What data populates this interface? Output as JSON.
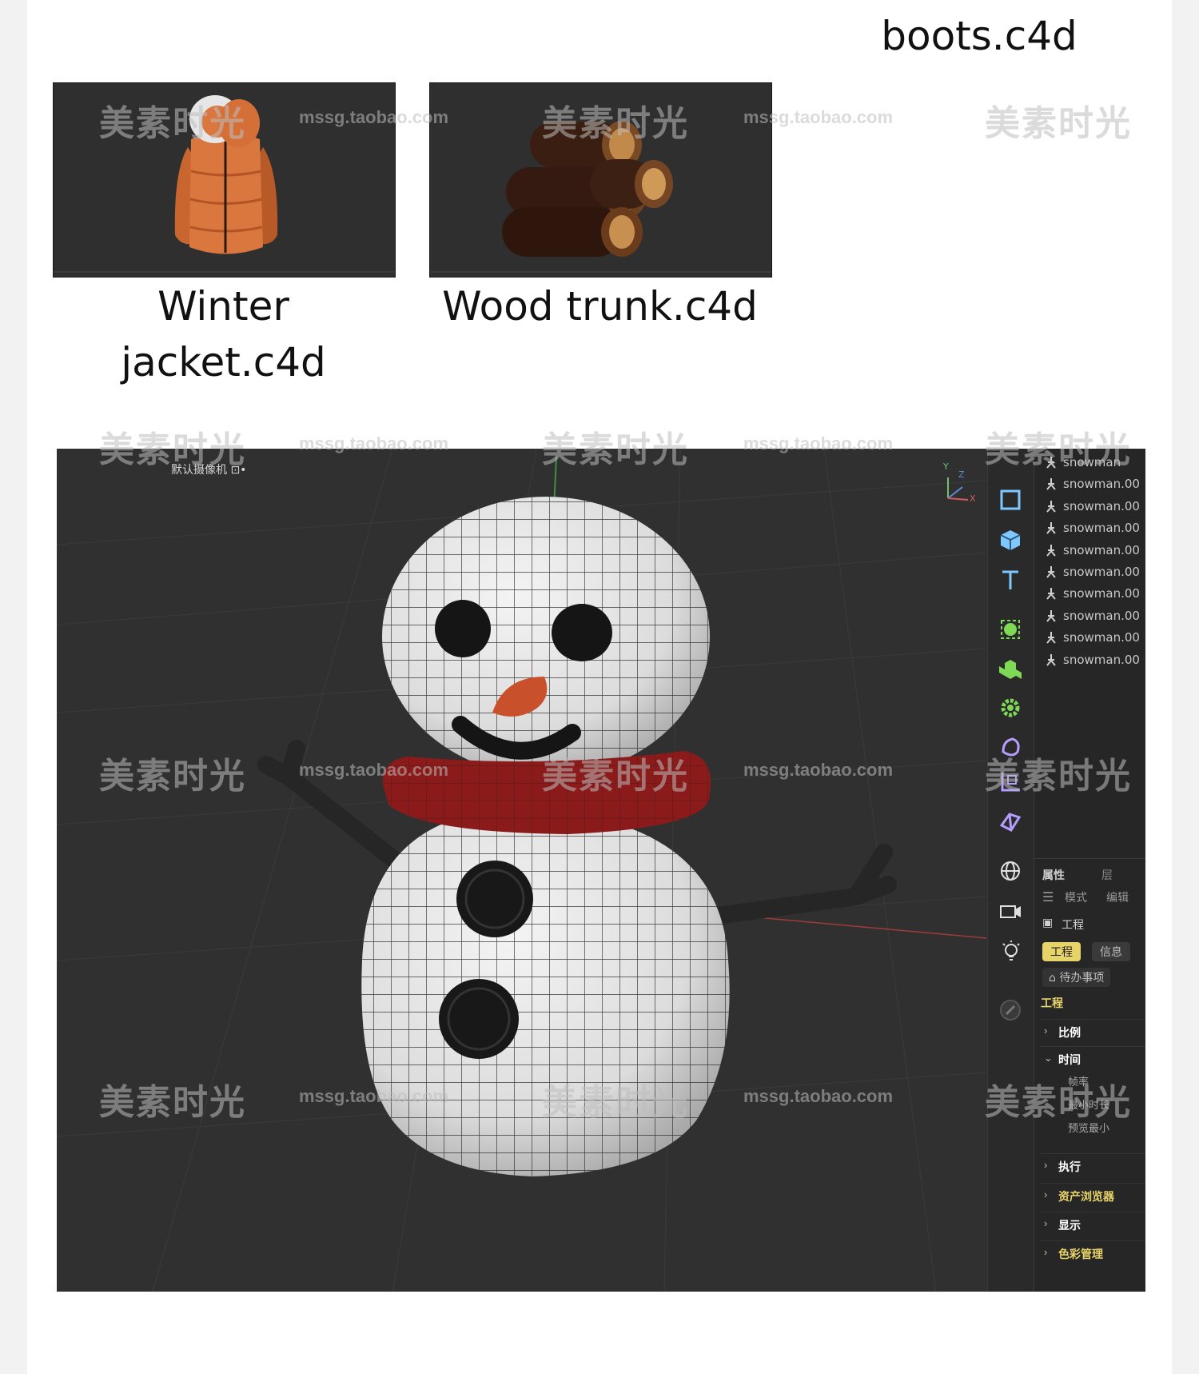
{
  "captions": {
    "top_right": "boots.c4d",
    "jacket_line1": "Winter",
    "jacket_line2": "jacket.c4d",
    "wood": "Wood trunk.c4d"
  },
  "watermark": {
    "cn": "美素时光",
    "url": "mssg.taobao.com"
  },
  "viewport": {
    "camera_label": "默认摄像机 ⊡•",
    "axis_y": "Y",
    "axis_z": "Z",
    "axis_x": "X"
  },
  "objects": [
    "snowman",
    "snowman.00",
    "snowman.00",
    "snowman.00",
    "snowman.00",
    "snowman.00",
    "snowman.00",
    "snowman.00",
    "snowman.00",
    "snowman.00"
  ],
  "attributes": {
    "tab_props": "属性",
    "tab_layers": "层",
    "mode": "模式",
    "edit": "编辑",
    "project_title": "工程",
    "btn_project": "工程",
    "btn_info": "信息",
    "todo": "待办事项",
    "section_header": "工程",
    "sections": {
      "scale": "比例",
      "time": "时间",
      "execute": "执行",
      "asset_browser": "资产浏览器",
      "display": "显示",
      "color_mgmt": "色彩管理"
    },
    "time_fields": {
      "fps": "帧率",
      "min_length": "最小时长",
      "preview_min": "预览最小"
    }
  },
  "colors": {
    "accent": "#e6d36a",
    "scarf": "#8b1a1a",
    "carrot": "#c8502a",
    "jacket": "#d9773f"
  }
}
